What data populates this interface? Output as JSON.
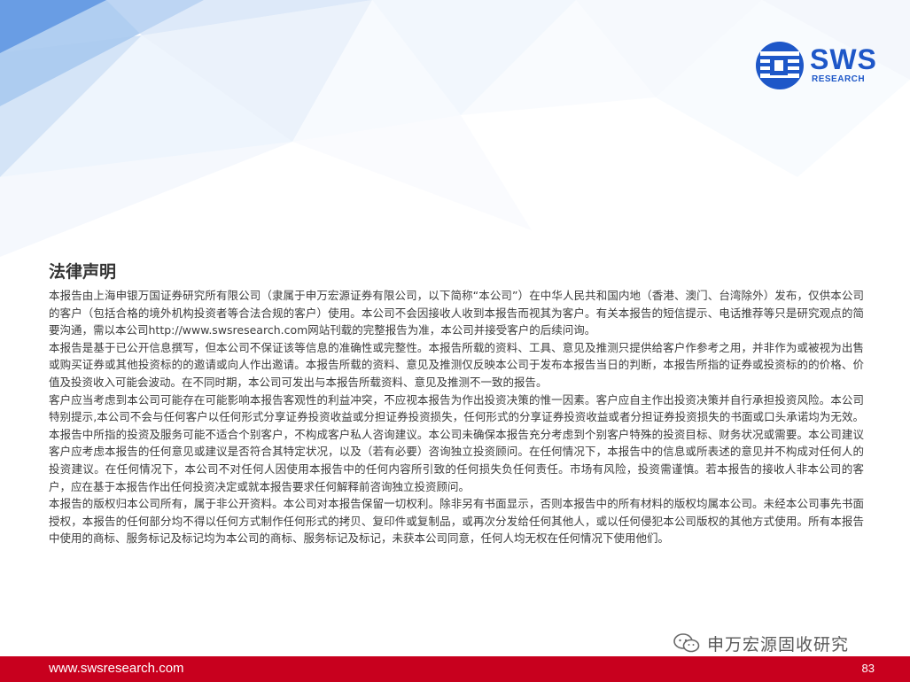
{
  "logo": {
    "name": "SWS",
    "sub": "RESEARCH"
  },
  "title": "法律声明",
  "paragraphs": [
    "本报告由上海申银万国证券研究所有限公司（隶属于申万宏源证券有限公司，以下简称“本公司”）在中华人民共和国内地（香港、澳门、台湾除外）发布，仅供本公司的客户（包括合格的境外机构投资者等合法合规的客户）使用。本公司不会因接收人收到本报告而视其为客户。有关本报告的短信提示、电话推荐等只是研究观点的简要沟通，需以本公司http://www.swsresearch.com网站刊载的完整报告为准，本公司并接受客户的后续问询。",
    "本报告是基于已公开信息撰写，但本公司不保证该等信息的准确性或完整性。本报告所载的资料、工具、意见及推测只提供给客户作参考之用，并非作为或被视为出售或购买证券或其他投资标的的邀请或向人作出邀请。本报告所载的资料、意见及推测仅反映本公司于发布本报告当日的判断，本报告所指的证券或投资标的的价格、价值及投资收入可能会波动。在不同时期，本公司可发出与本报告所载资料、意见及推测不一致的报告。",
    "客户应当考虑到本公司可能存在可能影响本报告客观性的利益冲突，不应视本报告为作出投资决策的惟一因素。客户应自主作出投资决策并自行承担投资风险。本公司特别提示,本公司不会与任何客户以任何形式分享证券投资收益或分担证券投资损失，任何形式的分享证券投资收益或者分担证券投资损失的书面或口头承诺均为无效。本报告中所指的投资及服务可能不适合个别客户，不构成客户私人咨询建议。本公司未确保本报告充分考虑到个别客户特殊的投资目标、财务状况或需要。本公司建议客户应考虑本报告的任何意见或建议是否符合其特定状况，以及（若有必要）咨询独立投资顾问。在任何情况下，本报告中的信息或所表述的意见并不构成对任何人的投资建议。在任何情况下，本公司不对任何人因使用本报告中的任何内容所引致的任何损失负任何责任。市场有风险，投资需谨慎。若本报告的接收人非本公司的客户，应在基于本报告作出任何投资决定或就本报告要求任何解释前咨询独立投资顾问。",
    "本报告的版权归本公司所有，属于非公开资料。本公司对本报告保留一切权利。除非另有书面显示，否则本报告中的所有材料的版权均属本公司。未经本公司事先书面授权，本报告的任何部分均不得以任何方式制作任何形式的拷贝、复印件或复制品，或再次分发给任何其他人，或以任何侵犯本公司版权的其他方式使用。所有本报告中使用的商标、服务标记及标记均为本公司的商标、服务标记及标记，未获本公司同意，任何人均无权在任何情况下使用他们。"
  ],
  "watermark": "申万宏源固收研究",
  "footer": {
    "url": "www.swsresearch.com",
    "page": "83"
  }
}
